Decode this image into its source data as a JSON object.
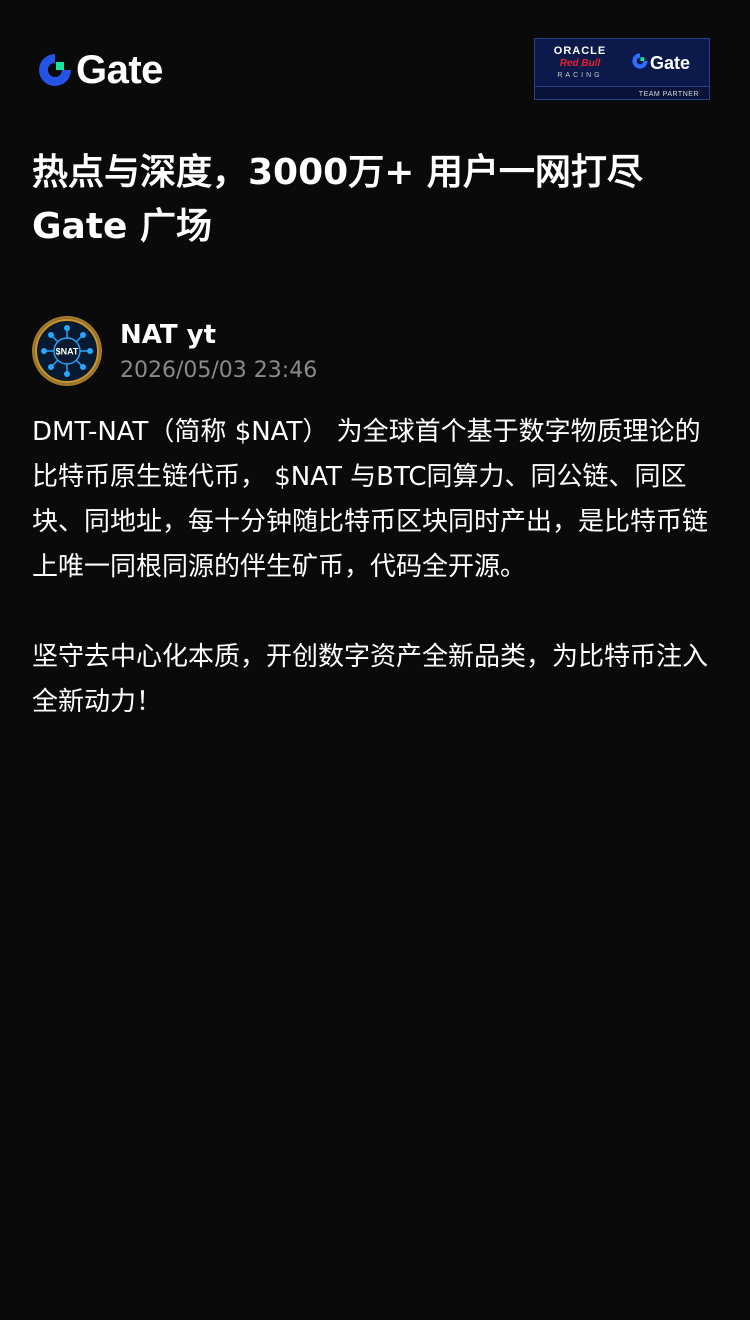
{
  "brand": {
    "logo_text": "Gate",
    "logo_icon": "gate-logo-icon",
    "accent_blue": "#2354e6",
    "accent_green": "#17e5a0"
  },
  "partner_badge": {
    "oracle": "ORACLE",
    "red_bull": "Red Bull",
    "racing": "RACING",
    "gate": "Gate",
    "team_partner": "TEAM PARTNER"
  },
  "headline": {
    "line1": "热点与深度，3000万+ 用户一网打尽",
    "line2": "Gate 广场"
  },
  "post": {
    "author_name": "NAT yt",
    "avatar_text": "$NAT",
    "timestamp": "2026/05/03 23:46",
    "paragraphs": [
      "DMT-NAT（简称 $NAT） 为全球首个基于数字物质理论的比特币原生链代币， $NAT 与BTC同算力、同公链、同区块、同地址，每十分钟随比特币区块同时产出，是比特币链上唯一同根同源的伴生矿币，代码全开源。",
      "坚守去中心化本质，开创数字资产全新品类，为比特币注入全新动力！"
    ]
  }
}
